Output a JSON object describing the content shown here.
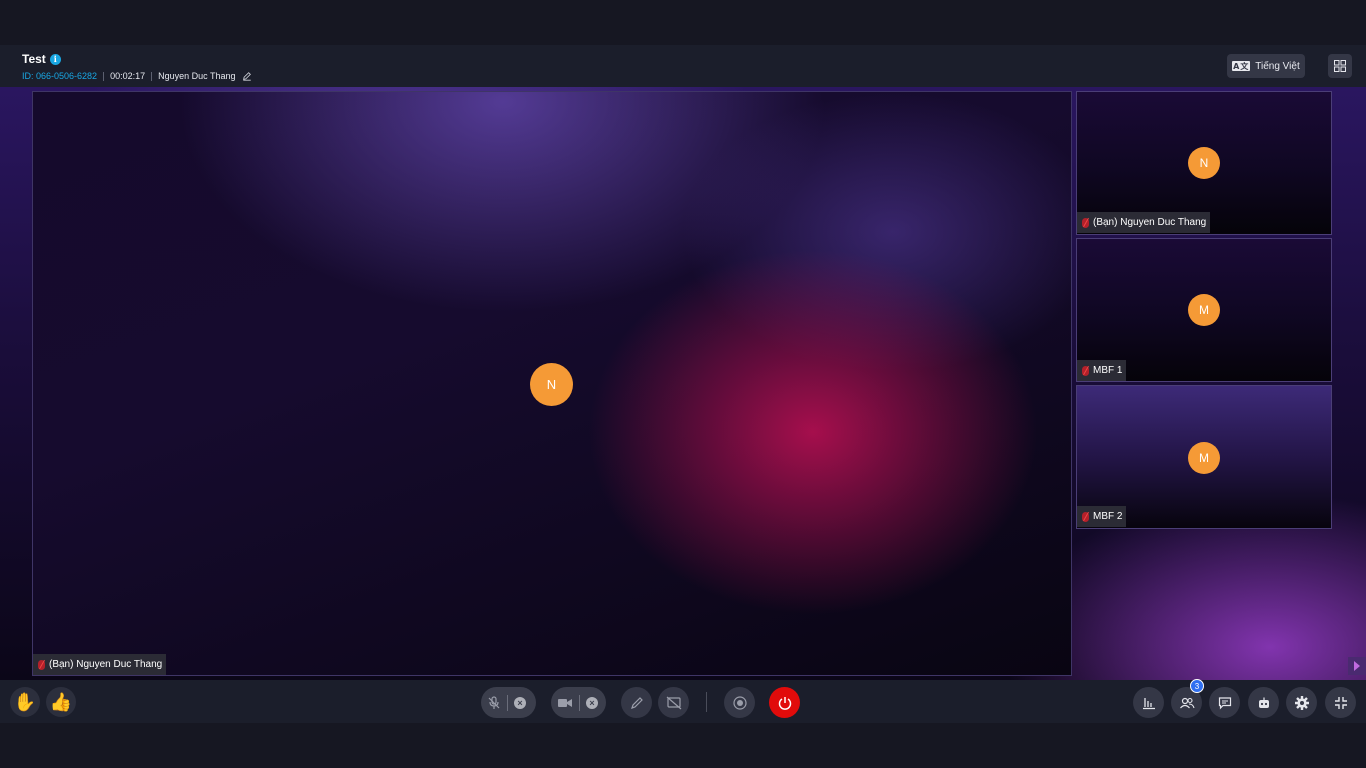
{
  "meeting": {
    "title": "Test",
    "id_text": "ID: 066-0506-6282",
    "elapsed": "00:02:17",
    "host_name": "Nguyen Duc Thang"
  },
  "header": {
    "language_label": "Tiếng Việt",
    "language_icon_text": "A文"
  },
  "main_tile": {
    "avatar_initial": "N",
    "name_tag": "(Bạn) Nguyen Duc Thang"
  },
  "side_tiles": [
    {
      "avatar_initial": "N",
      "name_tag": "(Bạn) Nguyen Duc Thang"
    },
    {
      "avatar_initial": "M",
      "name_tag": "MBF 1"
    },
    {
      "avatar_initial": "M",
      "name_tag": "MBF 2"
    }
  ],
  "toolbar": {
    "raise_hand_icon": "✋",
    "thumbs_up_icon": "👍",
    "participants_count": "3",
    "end_call_label": "···"
  },
  "colors": {
    "accent": "#19a7e3",
    "avatar": "#f59a36",
    "end_call": "#e10b0b",
    "badge": "#2f6ff0"
  }
}
